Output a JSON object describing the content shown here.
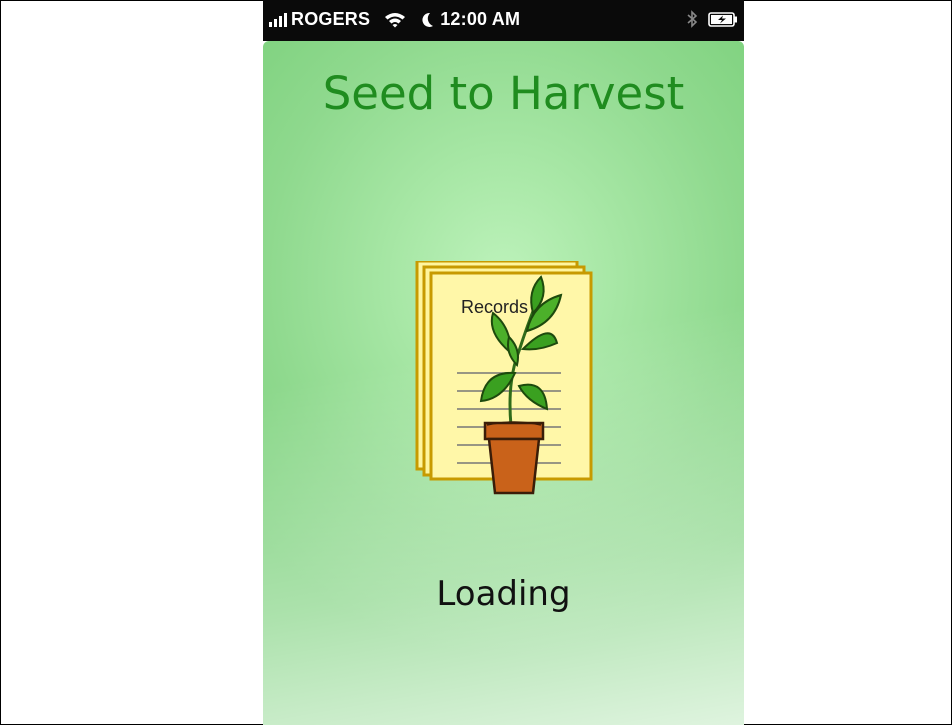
{
  "status_bar": {
    "carrier": "ROGERS",
    "time": "12:00 AM",
    "icons": [
      "signal-bars-icon",
      "wifi-icon",
      "moon-icon",
      "bluetooth-icon",
      "battery-charging-icon"
    ]
  },
  "app": {
    "title": "Seed to Harvest",
    "logo_label": "Records",
    "logo_icon": "plant-records-icon",
    "loading_text": "Loading"
  },
  "colors": {
    "title": "#1f8c1f",
    "background_green": "#8fd98e",
    "status_bar": "#0a0a0a"
  }
}
